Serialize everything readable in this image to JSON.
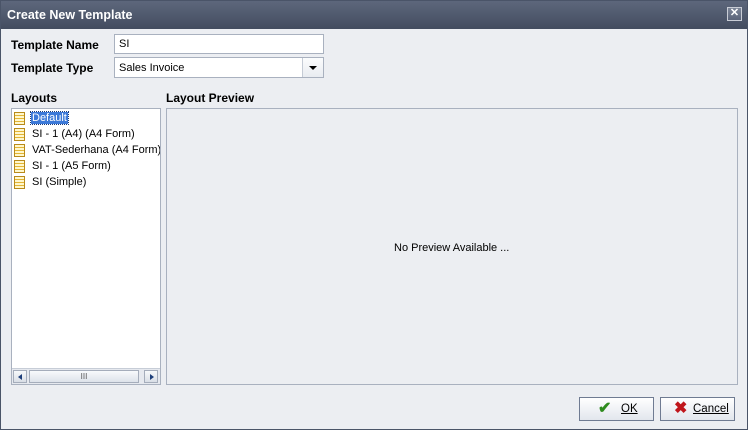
{
  "window": {
    "title": "Create New Template",
    "close_glyph": "✕"
  },
  "form": {
    "template_name_label": "Template Name",
    "template_name_value": "SI",
    "template_type_label": "Template Type",
    "template_type_value": "Sales Invoice"
  },
  "layouts": {
    "heading": "Layouts",
    "items": [
      {
        "label": "Default",
        "selected": true
      },
      {
        "label": "SI - 1 (A4) (A4 Form)",
        "selected": false
      },
      {
        "label": "VAT-Sederhana (A4 Form)",
        "selected": false
      },
      {
        "label": "SI - 1 (A5 Form)",
        "selected": false
      },
      {
        "label": "SI (Simple)",
        "selected": false
      }
    ],
    "scroll_thumb_grip": "III"
  },
  "preview": {
    "heading": "Layout Preview",
    "message": "No Preview Available ..."
  },
  "buttons": {
    "ok_label": "OK",
    "ok_icon": "check-icon",
    "ok_color": "#2e8b1e",
    "cancel_label": "Cancel",
    "cancel_icon": "x-icon",
    "cancel_color": "#c0161c"
  },
  "colors": {
    "titlebar": "#4d566b",
    "selection": "#3c79d8"
  }
}
